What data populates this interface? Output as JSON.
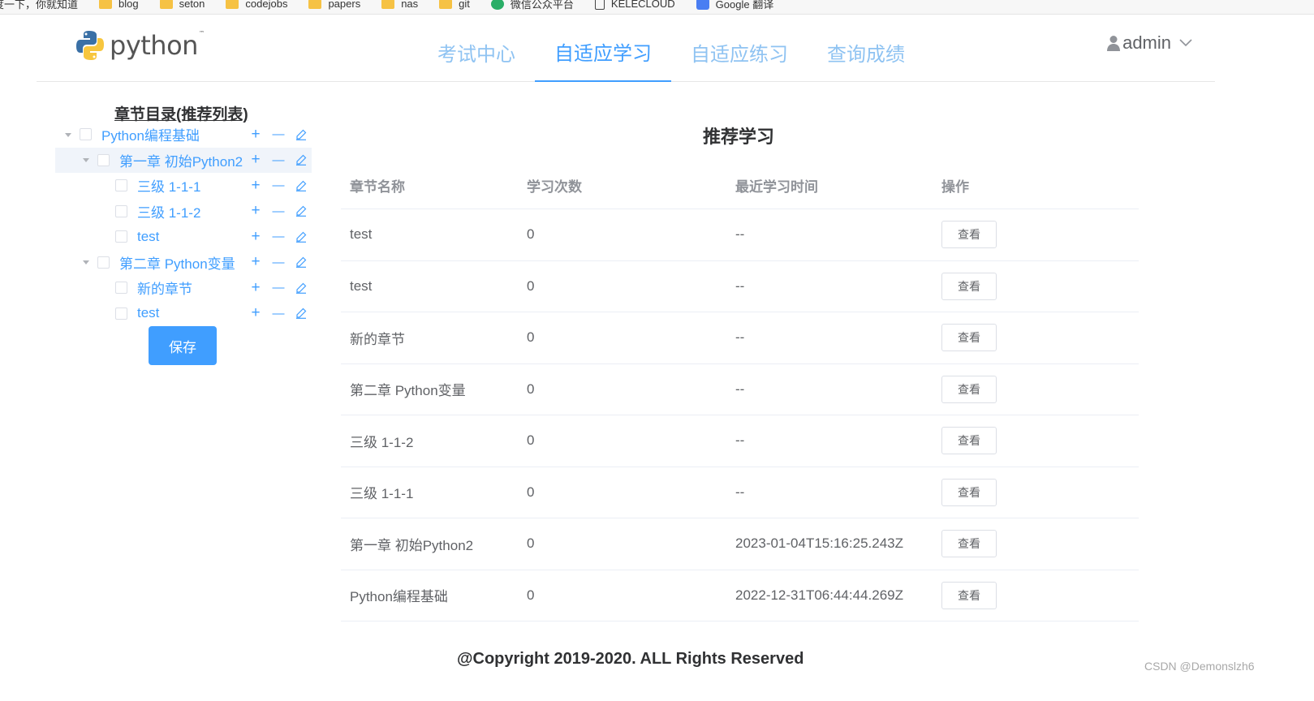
{
  "bookmarks": [
    {
      "label": "度一下，你就知道",
      "icon": "page-icon"
    },
    {
      "label": "blog",
      "icon": "folder-icon"
    },
    {
      "label": "seton",
      "icon": "folder-icon"
    },
    {
      "label": "codejobs",
      "icon": "folder-icon"
    },
    {
      "label": "papers",
      "icon": "folder-icon"
    },
    {
      "label": "nas",
      "icon": "folder-icon"
    },
    {
      "label": "git",
      "icon": "folder-icon"
    },
    {
      "label": "微信公众平台",
      "icon": "wechat-icon"
    },
    {
      "label": "KELECLOUD",
      "icon": "page-icon"
    },
    {
      "label": "Google 翻译",
      "icon": "google-translate-icon"
    }
  ],
  "header": {
    "logo_text": "python",
    "logo_tm": "™",
    "nav": [
      {
        "label": "考试中心",
        "active": false
      },
      {
        "label": "自适应学习",
        "active": true
      },
      {
        "label": "自适应练习",
        "active": false
      },
      {
        "label": "查询成绩",
        "active": false
      }
    ],
    "user": "admin"
  },
  "tree": {
    "title": "章节目录(推荐列表)",
    "nodes": [
      {
        "label": "Python编程基础",
        "level": 0,
        "expanded": true
      },
      {
        "label": "第一章 初始Python2",
        "level": 1,
        "expanded": true,
        "highlight": true
      },
      {
        "label": "三级 1-1-1",
        "level": 2
      },
      {
        "label": "三级 1-1-2",
        "level": 2
      },
      {
        "label": "test",
        "level": 2
      },
      {
        "label": "第二章 Python变量",
        "level": 1,
        "expanded": true
      },
      {
        "label": "新的章节",
        "level": 2
      },
      {
        "label": "test",
        "level": 2
      }
    ],
    "ops": {
      "add": "+",
      "remove": "—"
    },
    "save_label": "保存"
  },
  "main": {
    "title": "推荐学习",
    "columns": [
      "章节名称",
      "学习次数",
      "最近学习时间",
      "操作"
    ],
    "rows": [
      {
        "name": "test",
        "count": "0",
        "last": "--",
        "action": "查看"
      },
      {
        "name": "test",
        "count": "0",
        "last": "--",
        "action": "查看"
      },
      {
        "name": "新的章节",
        "count": "0",
        "last": "--",
        "action": "查看"
      },
      {
        "name": "第二章 Python变量",
        "count": "0",
        "last": "--",
        "action": "查看"
      },
      {
        "name": "三级 1-1-2",
        "count": "0",
        "last": "--",
        "action": "查看"
      },
      {
        "name": "三级 1-1-1",
        "count": "0",
        "last": "--",
        "action": "查看"
      },
      {
        "name": "第一章 初始Python2",
        "count": "0",
        "last": "2023-01-04T15:16:25.243Z",
        "action": "查看"
      },
      {
        "name": "Python编程基础",
        "count": "0",
        "last": "2022-12-31T06:44:44.269Z",
        "action": "查看"
      }
    ]
  },
  "footer": "@Copyright 2019-2020. ALL Rights Reserved",
  "watermark": "CSDN @Demonslzh6",
  "colors": {
    "accent": "#409eff",
    "nav_inactive": "#8fc3f2",
    "text": "#606266"
  }
}
